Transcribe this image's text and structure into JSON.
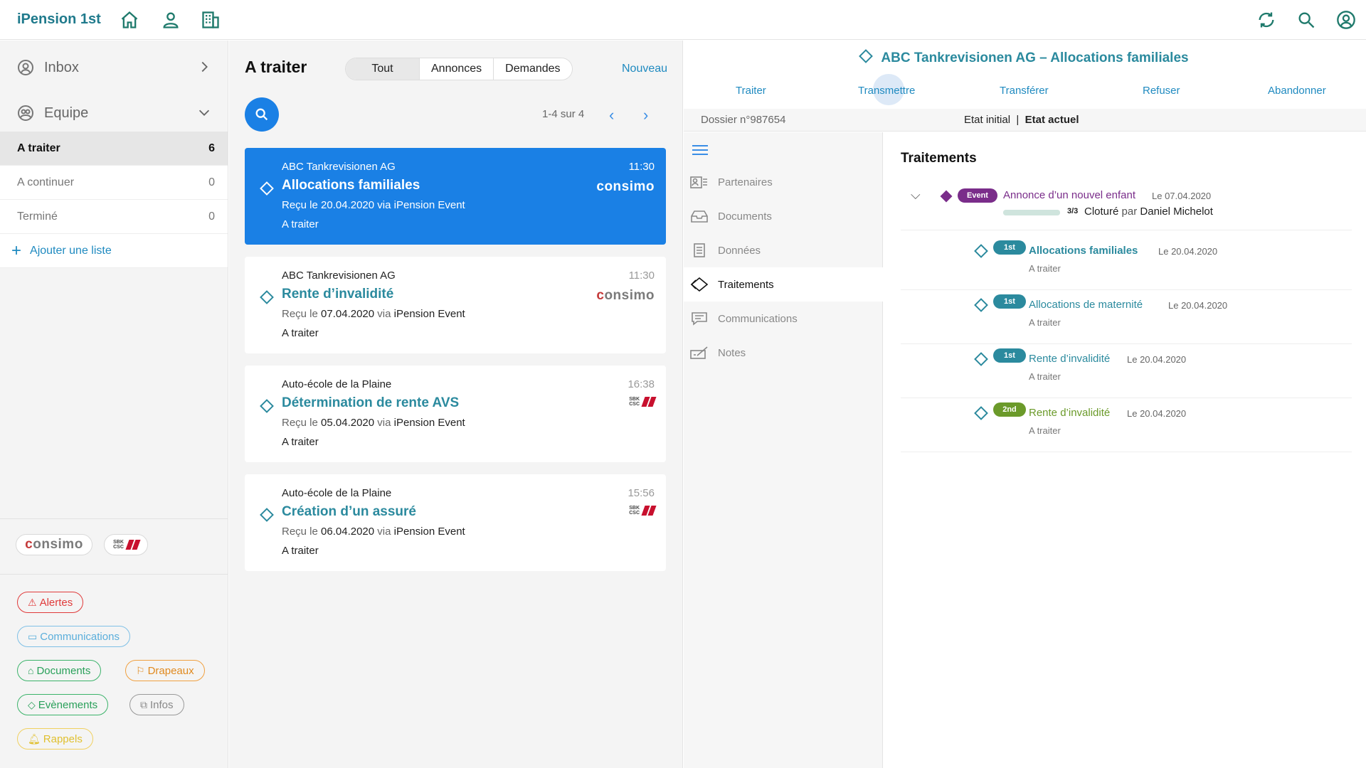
{
  "app": {
    "title": "iPension 1st",
    "nav_icons": [
      "home-icon",
      "person-icon",
      "building-icon"
    ],
    "right_icons": [
      "sync-icon",
      "search-icon",
      "account-icon"
    ]
  },
  "colors": {
    "teal": "#2b8a9e",
    "blue": "#1a80e5",
    "link": "#1f8ac0",
    "event_purple": "#7a2d8a",
    "badge_1st": "#2b8a9e",
    "badge_2nd": "#6b9a2a"
  },
  "sidebar": {
    "inbox": "Inbox",
    "equipe": "Equipe",
    "lists": [
      {
        "label": "A traiter",
        "count": "6",
        "active": true
      },
      {
        "label": "A continuer",
        "count": "0",
        "active": false
      },
      {
        "label": "Terminé",
        "count": "0",
        "active": false
      }
    ],
    "add_list": "Ajouter une liste",
    "brands": [
      "consimo",
      "sbk"
    ],
    "tags": {
      "alertes": "Alertes",
      "communications": "Communications",
      "documents": "Documents",
      "drapeaux": "Drapeaux",
      "evenements": "Evènements",
      "infos": "Infos",
      "rappels": "Rappels"
    }
  },
  "list": {
    "title": "A traiter",
    "filters": [
      "Tout",
      "Annonces",
      "Demandes"
    ],
    "selected_filter": "Tout",
    "new_label": "Nouveau",
    "pager": "1-4 sur 4",
    "cards": [
      {
        "org": "ABC Tankrevisionen AG",
        "time": "11:30",
        "subject": "Allocations familiales",
        "recv_prefix": "Reçu le",
        "recv_date": "20.04.2020",
        "recv_via": "via",
        "recv_source": "iPension Event",
        "state": "A traiter",
        "brand": "consimo",
        "selected": true
      },
      {
        "org": "ABC Tankrevisionen AG",
        "time": "11:30",
        "subject": "Rente d’invalidité",
        "recv_prefix": "Reçu le",
        "recv_date": "07.04.2020",
        "recv_via": "via",
        "recv_source": "iPension Event",
        "state": "A traiter",
        "brand": "consimo",
        "selected": false
      },
      {
        "org": "Auto-école de la Plaine",
        "time": "16:38",
        "subject": "Détermination de rente AVS",
        "recv_prefix": "Reçu le",
        "recv_date": "05.04.2020",
        "recv_via": "via",
        "recv_source": "iPension Event",
        "state": "A traiter",
        "brand": "sbk",
        "selected": false
      },
      {
        "org": "Auto-école de la Plaine",
        "time": "15:56",
        "subject": "Création d’un assuré",
        "recv_prefix": "Reçu le",
        "recv_date": "06.04.2020",
        "recv_via": "via",
        "recv_source": "iPension Event",
        "state": "A traiter",
        "brand": "sbk",
        "selected": false
      }
    ]
  },
  "detail": {
    "title": "ABC Tankrevisionen AG – Allocations familiales",
    "actions": [
      "Traiter",
      "Transmettre",
      "Transférer",
      "Refuser",
      "Abandonner"
    ],
    "dossier": "Dossier n°987654",
    "etat_initial": "Etat initial",
    "etat_sep": "|",
    "etat_actuel": "Etat actuel",
    "nav": [
      {
        "label": "Partenaires",
        "icon": "partners-icon",
        "active": false
      },
      {
        "label": "Documents",
        "icon": "inbox-tray-icon",
        "active": false
      },
      {
        "label": "Données",
        "icon": "document-icon",
        "active": false
      },
      {
        "label": "Traitements",
        "icon": "diamond-icon",
        "active": true
      },
      {
        "label": "Communications",
        "icon": "chat-icon",
        "active": false
      },
      {
        "label": "Notes",
        "icon": "note-pen-icon",
        "active": false
      }
    ],
    "treatments_title": "Traitements",
    "event": {
      "badge": "Event",
      "title": "Annonce d’un nouvel enfant",
      "date": "Le 07.04.2020",
      "progress": 1.0,
      "fraction": "3/3",
      "closed": "Cloturé",
      "by": "par",
      "person": "Daniel Michelot"
    },
    "treatments": [
      {
        "badge": "1st",
        "title": "Allocations familiales",
        "date": "Le 20.04.2020",
        "state": "A traiter",
        "bold": true
      },
      {
        "badge": "1st",
        "title": "Allocations de maternité",
        "date": "Le 20.04.2020",
        "state": "A traiter",
        "bold": false
      },
      {
        "badge": "1st",
        "title": "Rente d’invalidité",
        "date": "Le 20.04.2020",
        "state": "A traiter",
        "bold": false
      },
      {
        "badge": "2nd",
        "title": "Rente d’invalidité",
        "date": "Le 20.04.2020",
        "state": "A traiter",
        "bold": false
      }
    ]
  }
}
